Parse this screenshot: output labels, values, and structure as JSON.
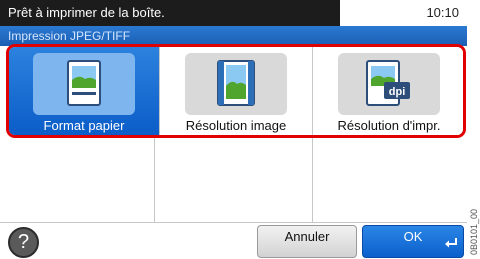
{
  "status_bar": {
    "message": "Prêt à imprimer de la boîte.",
    "time": "10:10"
  },
  "screen_title": "Impression JPEG/TIFF",
  "options": [
    {
      "label": "Format papier",
      "icon": "paper-size-icon",
      "selected": true
    },
    {
      "label": "Résolution image",
      "icon": "image-resolution-icon",
      "selected": false
    },
    {
      "label": "Résolution d'impr.",
      "icon": "print-resolution-icon",
      "icon_text": "dpi",
      "selected": false
    }
  ],
  "bottom_bar": {
    "help_label": "?",
    "cancel_label": "Annuler",
    "ok_label": "OK"
  },
  "figure_code": "0B0101_00",
  "colors": {
    "accent_blue": "#0b5dc8",
    "highlight_red": "#e10000",
    "status_bg": "#1c1c1c"
  }
}
